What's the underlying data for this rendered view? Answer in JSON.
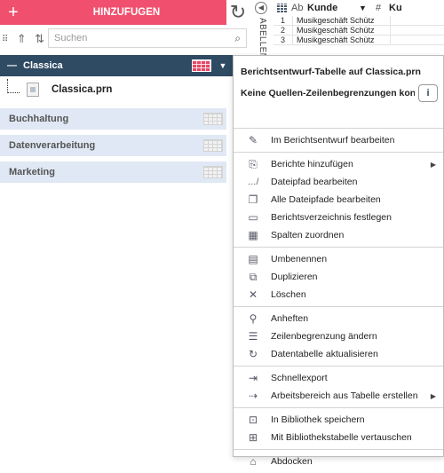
{
  "toolbar": {
    "add_label": "HINZUFUGEN",
    "search_placeholder": "Suchen"
  },
  "tree": {
    "expanded_group": "Classica",
    "file_name": "Classica.prn",
    "groups": [
      "Buchhaltung",
      "Datenverarbeitung",
      "Marketing"
    ]
  },
  "side_tab": {
    "label": "ABELLEN"
  },
  "grid": {
    "ab_label": "Ab",
    "column_name": "Kunde",
    "hash": "#",
    "column2_partial": "Ku",
    "rows": [
      {
        "num": "1",
        "value": "Musikgeschäft Schütz"
      },
      {
        "num": "2",
        "value": "Musikgeschäft Schütz"
      },
      {
        "num": "3",
        "value": "Musikgeschäft Schütz"
      }
    ]
  },
  "context_menu": {
    "header_line1": "Berichtsentwurf-Tabelle auf Classica.prn",
    "header_line2": "Keine Quellen-Zeilenbegrenzungen konf…",
    "info_label": "i",
    "sections": [
      [
        {
          "label": "Im Berichtsentwurf bearbeiten",
          "icon": "pencil-icon"
        }
      ],
      [
        {
          "label": "Berichte hinzufügen",
          "icon": "add-report-icon",
          "submenu": true
        },
        {
          "label": "Dateipfad bearbeiten",
          "icon": "path-icon"
        },
        {
          "label": "Alle Dateipfade bearbeiten",
          "icon": "all-paths-icon"
        },
        {
          "label": "Berichtsverzeichnis festlegen",
          "icon": "folder-icon"
        },
        {
          "label": "Spalten zuordnen",
          "icon": "columns-icon"
        }
      ],
      [
        {
          "label": "Umbenennen",
          "icon": "rename-icon"
        },
        {
          "label": "Duplizieren",
          "icon": "duplicate-icon"
        },
        {
          "label": "Löschen",
          "icon": "delete-icon"
        }
      ],
      [
        {
          "label": "Anheften",
          "icon": "pin-icon"
        },
        {
          "label": "Zeilenbegrenzung ändern",
          "icon": "row-limit-icon"
        },
        {
          "label": "Datentabelle aktualisieren",
          "icon": "refresh-icon"
        }
      ],
      [
        {
          "label": "Schnellexport",
          "icon": "export-icon"
        },
        {
          "label": "Arbeitsbereich aus Tabelle erstellen",
          "icon": "workspace-icon",
          "submenu": true
        }
      ],
      [
        {
          "label": "In Bibliothek speichern",
          "icon": "library-save-icon"
        },
        {
          "label": "Mit Bibliothekstabelle vertauschen",
          "icon": "library-swap-icon"
        }
      ],
      [
        {
          "label": "Abdocken",
          "icon": "undock-icon"
        }
      ]
    ]
  },
  "colors": {
    "accent": "#f0506e",
    "header_bg": "#2f4a63",
    "group_bg": "#dfe8f4"
  }
}
